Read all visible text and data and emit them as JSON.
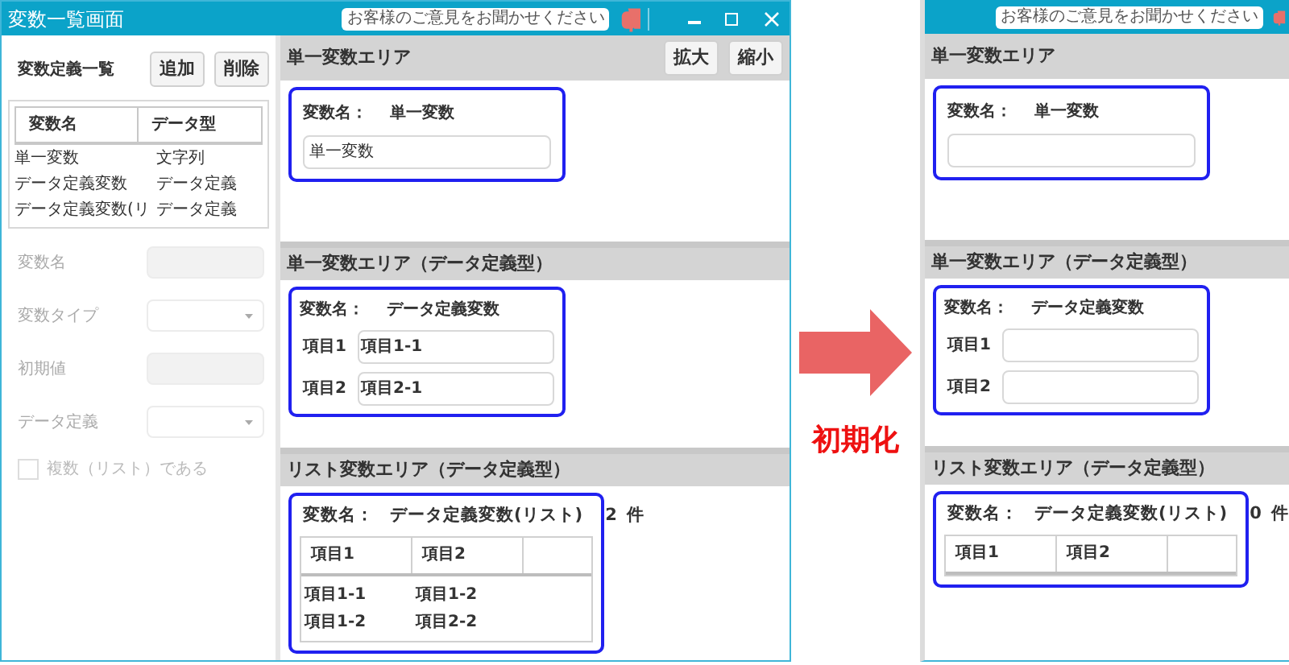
{
  "before": {
    "window": {
      "title": "変数一覧画面",
      "feedback": "お客様のご意見をお聞かせください"
    },
    "sidebar": {
      "title": "変数定義一覧",
      "buttons": [
        "追加",
        "削除"
      ],
      "columns": [
        "変数名",
        "データ型"
      ],
      "rows": [
        [
          "単一変数",
          "文字列"
        ],
        [
          "データ定義変数",
          "データ定義"
        ],
        [
          "データ定義変数(リ",
          "データ定義"
        ]
      ],
      "fields": [
        {
          "label": "変数名",
          "kind": "text",
          "disabled": true
        },
        {
          "label": "変数タイプ",
          "kind": "select",
          "disabled": true
        },
        {
          "label": "初期値",
          "kind": "text",
          "disabled": true
        },
        {
          "label": "データ定義",
          "kind": "select",
          "disabled": true
        }
      ],
      "checkbox": {
        "label": "複数（リスト）である",
        "checked": false,
        "disabled": true
      }
    },
    "areas": [
      {
        "kind": "single",
        "header": "単一変数エリア",
        "buttons": [
          "拡大",
          "縮小"
        ],
        "name_label": "変数名：",
        "name": "単一変数",
        "value": "単一変数"
      },
      {
        "kind": "record",
        "header": "単一変数エリア（データ定義型）",
        "name_label": "変数名：",
        "name": "データ定義変数",
        "fields": [
          {
            "label": "項目1",
            "value": "項目1-1"
          },
          {
            "label": "項目2",
            "value": "項目2-1"
          }
        ]
      },
      {
        "kind": "list",
        "header": "リスト変数エリア（データ定義型）",
        "name_label": "変数名：",
        "name": "データ定義変数(リスト)",
        "count": "2",
        "unit": "件",
        "columns": [
          "項目1",
          "項目2"
        ],
        "rows": [
          [
            "項目1-1",
            "項目1-2"
          ],
          [
            "項目1-2",
            "項目2-2"
          ]
        ]
      }
    ]
  },
  "transition": {
    "label": "初期化"
  },
  "after": {
    "window": {
      "feedback": "お客様のご意見をお聞かせください"
    },
    "areas": [
      {
        "kind": "single",
        "header": "単一変数エリア",
        "name_label": "変数名：",
        "name": "単一変数"
      },
      {
        "kind": "record",
        "header": "単一変数エリア（データ定義型）",
        "name_label": "変数名：",
        "name": "データ定義変数",
        "fields": [
          {
            "label": "項目1"
          },
          {
            "label": "項目2"
          }
        ]
      },
      {
        "kind": "list",
        "header": "リスト変数エリア（データ定義型）",
        "name_label": "変数名：",
        "name": "データ定義変数(リスト)",
        "count": "0",
        "unit": "件",
        "columns": [
          "項目1",
          "項目2"
        ]
      }
    ]
  }
}
